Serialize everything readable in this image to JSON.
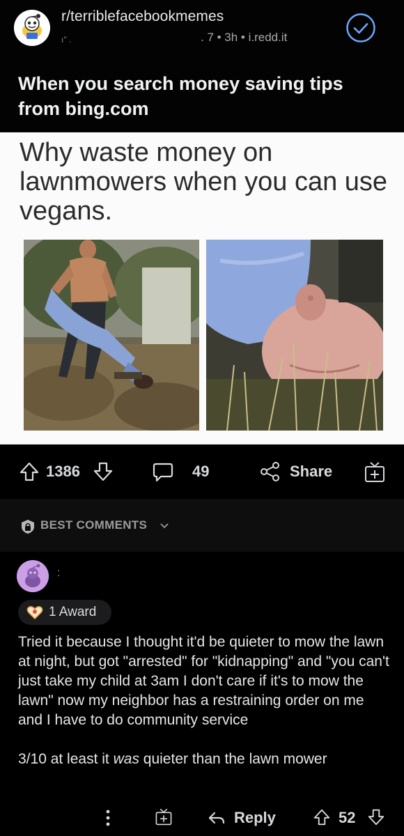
{
  "post": {
    "subreddit": "r/terriblefacebookmemes",
    "meta_left": "ı'' .",
    "meta_right": ". 7 • 3h • i.redd.it",
    "title": "When you search money saving tips from bing.com",
    "image_caption": "Why waste money on lawnmowers when you can use vegans."
  },
  "actions": {
    "upvotes": "1386",
    "comments": "49",
    "share": "Share"
  },
  "sort": {
    "label": "BEST COMMENTS"
  },
  "comment": {
    "username": ":",
    "award": "1 Award",
    "body_line1": "Tried it because I thought it'd be quieter to mow the lawn at night, but got \"arrested\" for \"kidnapping\" and \"you can't just take my child at 3am I don't care if it's to mow the lawn\" now my neighbor has a restraining order on me and I have to do community service",
    "body_line2_pre": "3/10 at least it ",
    "body_line2_em": "was",
    "body_line2_post": " quieter than the lawn mower",
    "reply": "Reply",
    "votes": "52"
  },
  "colors": {
    "background": "#000000",
    "accent_check": "#6aa9ff",
    "avatar_comment": "#cb9ee6"
  },
  "icons": [
    "snoo-icon",
    "check-circle-icon",
    "upvote-icon",
    "downvote-icon",
    "comment-bubble-icon",
    "share-icon",
    "award-icon",
    "shield-icon",
    "chevron-down-icon",
    "more-dots-icon",
    "reply-arrow-icon"
  ]
}
